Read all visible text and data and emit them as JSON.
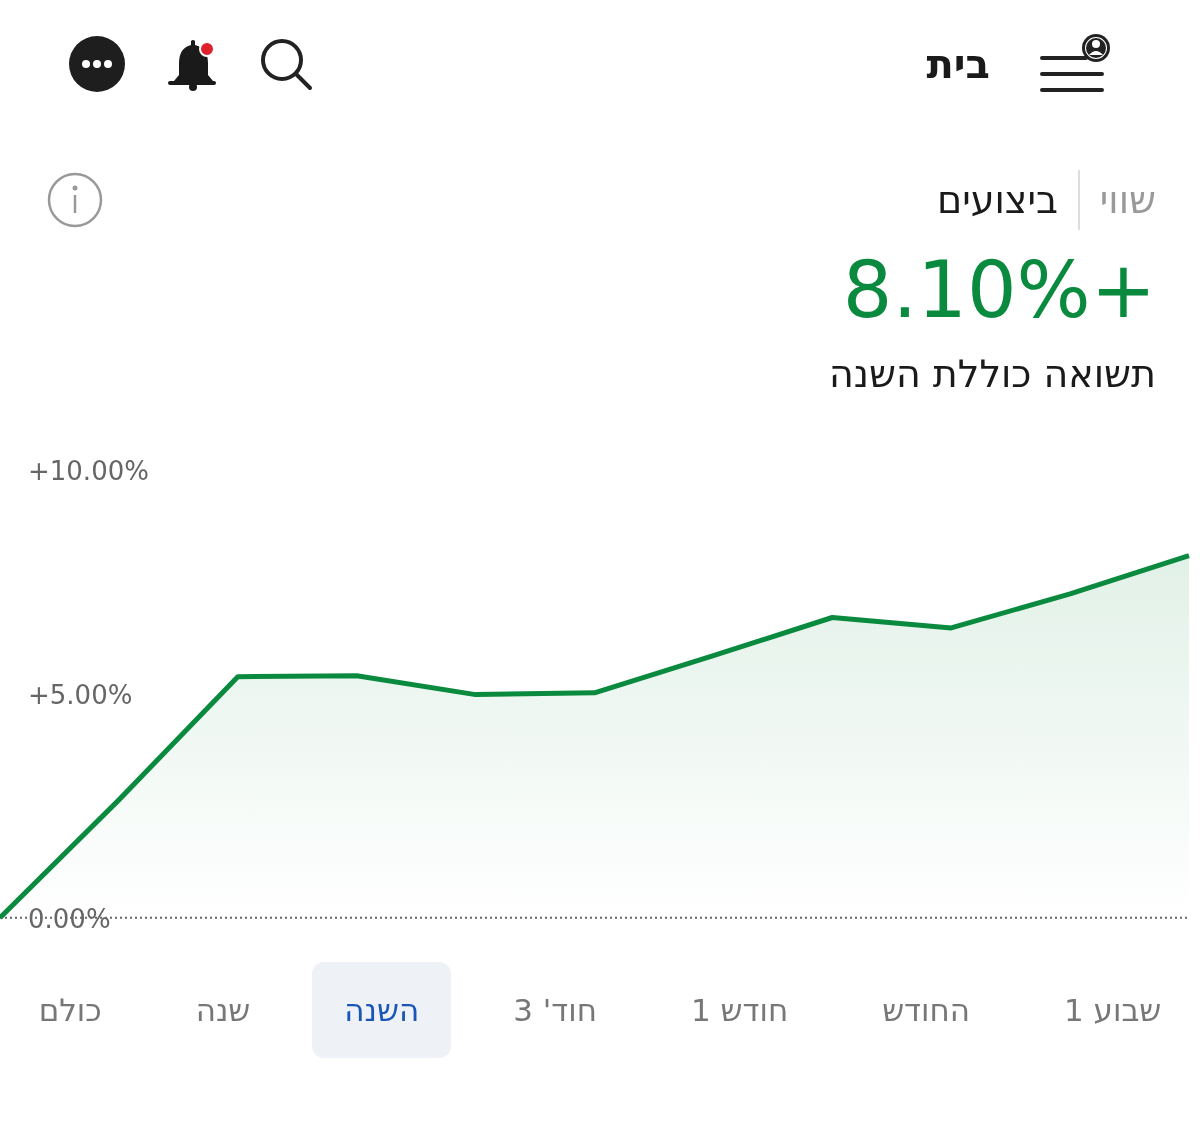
{
  "header": {
    "title": "בית",
    "notification_dot": true
  },
  "view_tabs": [
    {
      "label": "שווי",
      "selected": false
    },
    {
      "label": "ביצועים",
      "selected": true
    }
  ],
  "return": {
    "value": "+8.10%",
    "label": "תשואה כוללת השנה"
  },
  "chart_data": {
    "type": "area",
    "ylim": [
      -4.96,
      20.46
    ],
    "yticks": [
      {
        "value": 0,
        "label": "0.00%"
      },
      {
        "value": 5,
        "label": "+5.00%"
      },
      {
        "value": 10,
        "label": "+10.00%"
      }
    ],
    "series": [
      {
        "color": "#0a8a3e",
        "values": [
          0,
          2.63,
          5.38,
          5.4,
          4.98,
          5.02,
          5.85,
          6.7,
          6.47,
          7.23,
          8.08
        ]
      }
    ]
  },
  "range_tabs": [
    {
      "label": "שבוע 1",
      "selected": false
    },
    {
      "label": "החודש",
      "selected": false
    },
    {
      "label": "חודש 1",
      "selected": false
    },
    {
      "label": "חוד' 3",
      "selected": false
    },
    {
      "label": "השנה",
      "selected": true
    },
    {
      "label": "שנה",
      "selected": false
    },
    {
      "label": "כולם",
      "selected": false
    }
  ]
}
